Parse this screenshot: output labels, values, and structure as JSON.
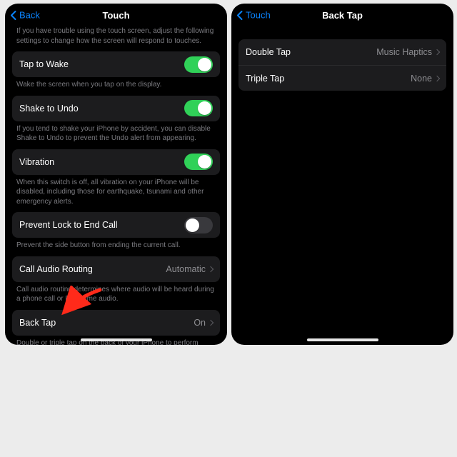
{
  "left": {
    "nav": {
      "back": "Back",
      "title": "Touch"
    },
    "intro": "If you have trouble using the touch screen, adjust the following settings to change how the screen will respond to touches.",
    "tapToWake": {
      "label": "Tap to Wake",
      "on": true,
      "footer": "Wake the screen when you tap on the display."
    },
    "shakeUndo": {
      "label": "Shake to Undo",
      "on": true,
      "footer": "If you tend to shake your iPhone by accident, you can disable Shake to Undo to prevent the Undo alert from appearing."
    },
    "vibration": {
      "label": "Vibration",
      "on": true,
      "footer": "When this switch is off, all vibration on your iPhone will be disabled, including those for earthquake, tsunami and other emergency alerts."
    },
    "preventLock": {
      "label": "Prevent Lock to End Call",
      "on": false,
      "footer": "Prevent the side button from ending the current call."
    },
    "callAudio": {
      "label": "Call Audio Routing",
      "value": "Automatic",
      "footer": "Call audio routing determines where audio will be heard during a phone call or FaceTime audio."
    },
    "backTap": {
      "label": "Back Tap",
      "value": "On",
      "footer": "Double or triple tap on the back of your iPhone to perform actions quickly."
    }
  },
  "right": {
    "nav": {
      "back": "Touch",
      "title": "Back Tap"
    },
    "double": {
      "label": "Double Tap",
      "value": "Music Haptics"
    },
    "triple": {
      "label": "Triple Tap",
      "value": "None"
    }
  }
}
